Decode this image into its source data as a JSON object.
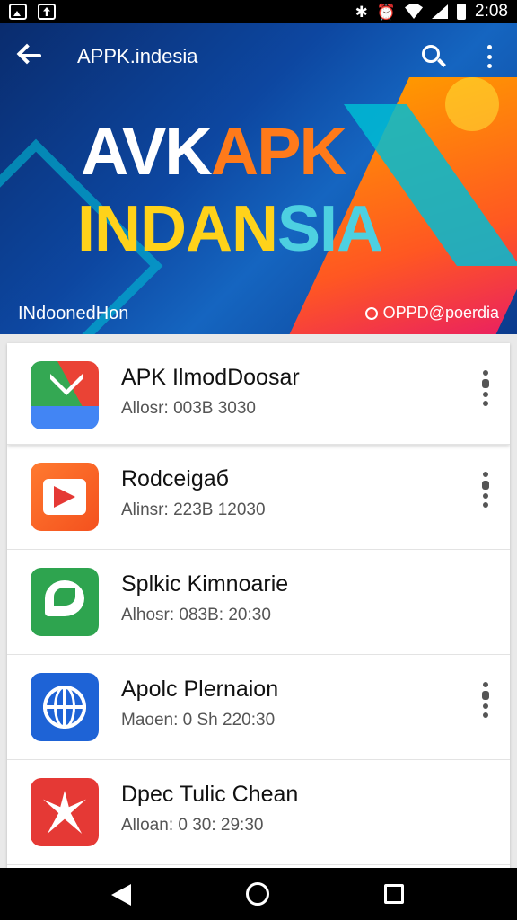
{
  "status_bar": {
    "time": "2:08",
    "icons": [
      "image-icon",
      "upload-icon",
      "bluetooth-icon",
      "alarm-icon",
      "wifi-icon",
      "signal-icon",
      "battery-icon"
    ]
  },
  "app_bar": {
    "title": "APPK.indesia",
    "icons": [
      "back-arrow-icon",
      "search-icon",
      "more-vert-icon"
    ]
  },
  "banner": {
    "line1_part1": "AVK",
    "line1_part2": "APK",
    "line2_part1": "INDAN",
    "line2_part2": "SIA",
    "bottom_left": "INdoonedHon",
    "bottom_right": "OPPD@poerdia",
    "colors": {
      "background": "#0d47a1",
      "accent_orange": "#ff7a1a",
      "accent_yellow": "#ffd21a",
      "accent_cyan": "#4dd0e1"
    }
  },
  "app_list": {
    "items": [
      {
        "title": "APK IlmodDoosar",
        "subtitle": "Allosr: 003B  3030",
        "icon": "mail-icon",
        "has_menu": true
      },
      {
        "title": "Rodceigaб",
        "subtitle": "Alinsr: 223B 12030",
        "icon": "video-play-icon",
        "has_menu": true
      },
      {
        "title": "Splkic Kimnoarie",
        "subtitle": "Alhosr: 083B:  20:30",
        "icon": "chat-leaf-icon",
        "has_menu": false
      },
      {
        "title": "Apolc Plernaion",
        "subtitle": "Maoen: 0 Sh  220:30",
        "icon": "globe-icon",
        "has_menu": true
      },
      {
        "title": "Dpec Tulic Chean",
        "subtitle": "Alloan: 0 30:  29:30",
        "icon": "star-icon",
        "has_menu": false
      }
    ]
  },
  "nav_bar": {
    "icons": [
      "nav-back-icon",
      "nav-home-icon",
      "nav-recents-icon"
    ]
  }
}
